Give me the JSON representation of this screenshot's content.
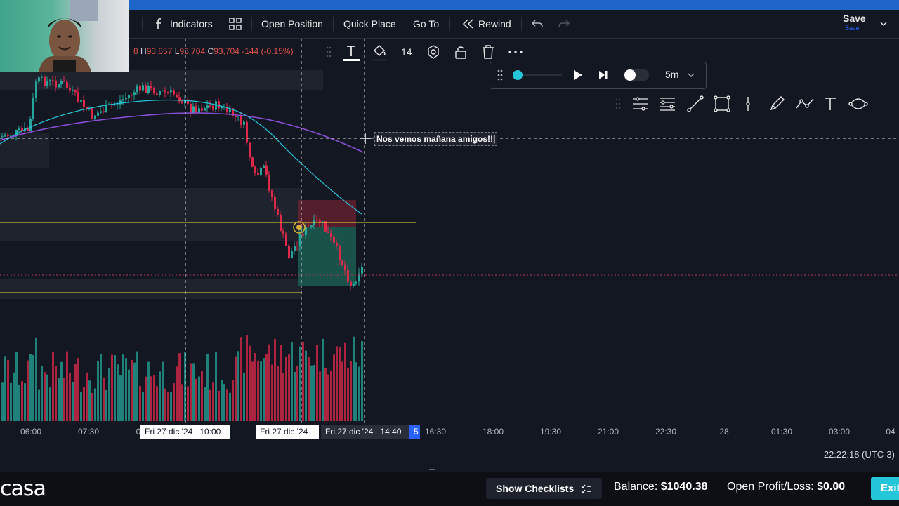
{
  "toolbar": {
    "indicators": "Indicators",
    "open_position": "Open Position",
    "quick_place": "Quick Place",
    "go_to": "Go To",
    "rewind": "Rewind",
    "save": "Save",
    "save_sub": "Save"
  },
  "ohlc": {
    "o_val": "8",
    "h_key": "H",
    "h_val": "93,857",
    "l_key": "L",
    "l_val": "93,704",
    "c_key": "C",
    "c_val": "93,704",
    "change": "-144 (-0.15%)"
  },
  "drawing_toolbar": {
    "font_size": "14"
  },
  "replay": {
    "interval": "5m",
    "progress_fraction": 0.05
  },
  "annotation": {
    "text": "Nos vemos mañana amigos!!|"
  },
  "time_axis": {
    "labels": [
      "06:00",
      "07:30",
      "0",
      "16:30",
      "18:00",
      "19:30",
      "21:00",
      "22:30",
      "28",
      "01:30",
      "03:00",
      "04"
    ],
    "crosshair_1": "Fri 27 dic '24   10:00",
    "crosshair_2": "Fri 27 dic '24",
    "crosshair_3_date": "Fri 27 dic '24",
    "crosshair_3_time": "14:40",
    "cursor_label": "5"
  },
  "clock": "22:22:18 (UTC-3)",
  "bottom": {
    "logo": "casa",
    "show_checklists": "Show Checklists",
    "balance_label": "Balance:",
    "balance_value": "$1040.38",
    "pl_label": "Open Profit/Loss:",
    "pl_value": "$0.00",
    "exit": "Exit"
  },
  "colors": {
    "background": "#131722",
    "bull": "#26a69a",
    "bear": "#e0294a",
    "accent": "#26c6da",
    "ma_fast": "#26c6da",
    "ma_slow": "#8a4fd6",
    "level_line": "#e8e03a"
  }
}
